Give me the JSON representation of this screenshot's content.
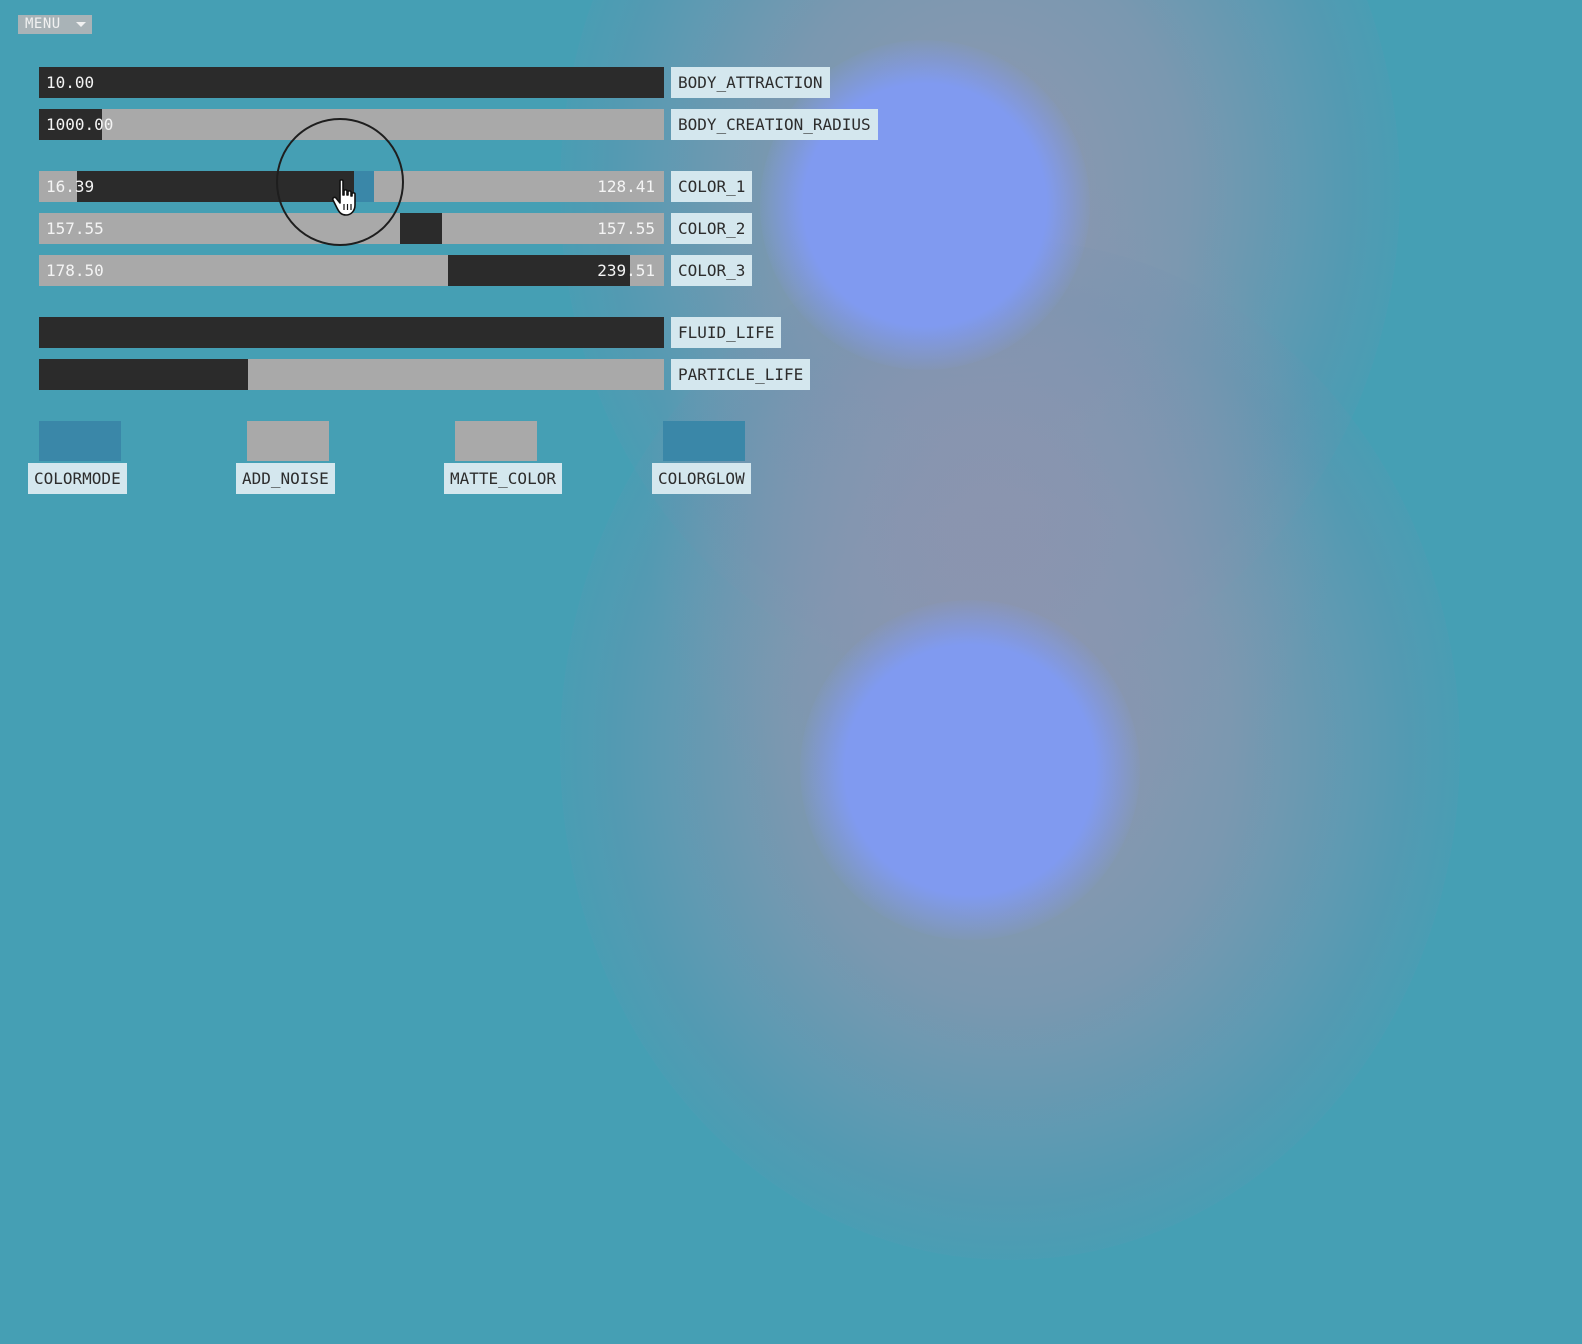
{
  "menu": {
    "label": "MENU",
    "icon": "caret-down-icon"
  },
  "sliders": {
    "body_attraction": {
      "label": "BODY_ATTRACTION",
      "value": "10.00",
      "fill_fraction": 1.0
    },
    "body_creation_radius": {
      "label": "BODY_CREATION_RADIUS",
      "value": "1000.00",
      "fill_fraction": 0.1
    }
  },
  "range_sliders": {
    "color_1": {
      "label": "COLOR_1",
      "low": "16.39",
      "high": "128.41",
      "range_start_fraction": 0.06,
      "range_end_fraction": 0.506
    },
    "color_2": {
      "label": "COLOR_2",
      "low": "157.55",
      "high": "157.55",
      "range_start_fraction": 0.578,
      "range_end_fraction": 0.645
    },
    "color_3": {
      "label": "COLOR_3",
      "low": "178.50",
      "high": "239.51",
      "range_start_fraction": 0.654,
      "range_end_fraction": 0.945
    }
  },
  "life_sliders": {
    "fluid_life": {
      "label": "FLUID_LIFE",
      "fill_fraction": 1.0
    },
    "particle_life": {
      "label": "PARTICLE_LIFE",
      "fill_fraction": 0.334
    }
  },
  "toggles": {
    "colormode": {
      "label": "COLORMODE",
      "on": true
    },
    "add_noise": {
      "label": "ADD_NOISE",
      "on": false
    },
    "matte_color": {
      "label": "MATTE_COLOR",
      "on": false
    },
    "colorglow": {
      "label": "COLORGLOW",
      "on": true
    }
  },
  "colors": {
    "background": "#459fb4",
    "slider_track": "#a9a9a9",
    "slider_fill": "#2b2b2b",
    "active_handle": "#3a87a8",
    "label_background": "#d4e7ee",
    "toggle_on": "#3a87a8",
    "toggle_off": "#a9a9a9",
    "orb": "#809af0"
  },
  "cursor": {
    "icon": "hand-pointer-icon"
  }
}
